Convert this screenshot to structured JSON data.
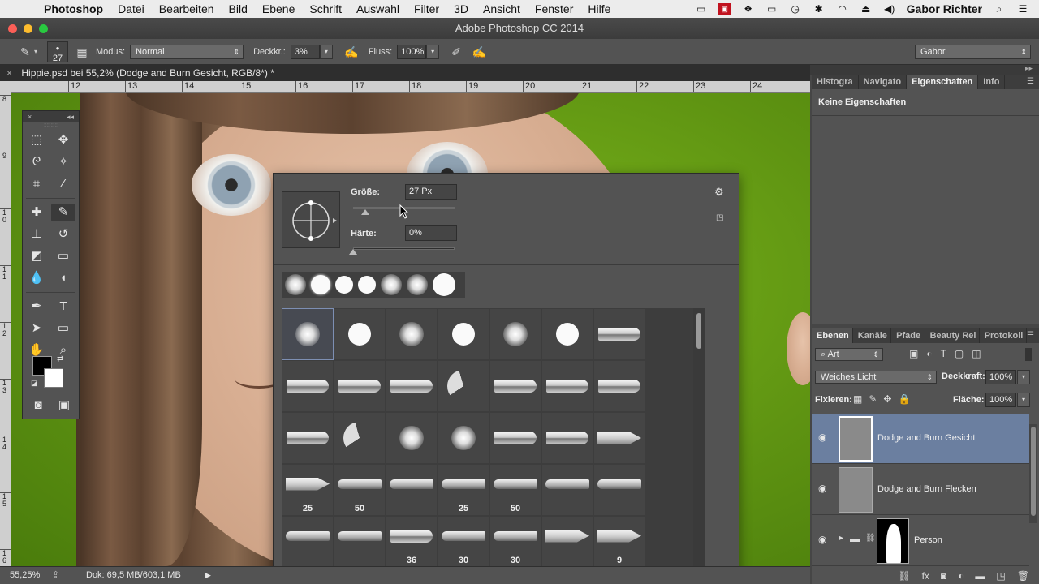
{
  "menubar": {
    "app_name": "Photoshop",
    "items": [
      "Datei",
      "Bearbeiten",
      "Bild",
      "Ebene",
      "Schrift",
      "Auswahl",
      "Filter",
      "3D",
      "Ansicht",
      "Fenster",
      "Hilfe"
    ],
    "user": "Gabor Richter"
  },
  "window": {
    "title": "Adobe Photoshop CC 2014"
  },
  "options": {
    "brush_size": "27",
    "mode_label": "Modus:",
    "mode_value": "Normal",
    "opacity_label": "Deckkr.:",
    "opacity_value": "3%",
    "flow_label": "Fluss:",
    "flow_value": "100%",
    "workspace": "Gabor"
  },
  "document": {
    "tab_title": "Hippie.psd bei 55,2% (Dodge and Burn Gesicht, RGB/8*) *",
    "ruler_h": [
      "12",
      "13",
      "14",
      "15",
      "16",
      "17",
      "18",
      "19",
      "20",
      "21",
      "22",
      "23",
      "24"
    ],
    "ruler_v": [
      "8",
      "9",
      "1\n0",
      "1\n1",
      "1\n2",
      "1\n3",
      "1\n4",
      "1\n5",
      "1\n6"
    ]
  },
  "brush_picker": {
    "size_label": "Größe:",
    "size_value": "27 Px",
    "size_fraction": 0.12,
    "hardness_label": "Härte:",
    "hardness_value": "0%",
    "hardness_fraction": 0.0,
    "preset_numbers": [
      "25",
      "50",
      "",
      "25",
      "50",
      "",
      "",
      "",
      "",
      "36",
      "30",
      "30",
      "",
      "9"
    ]
  },
  "properties": {
    "tabs": [
      "Histogra",
      "Navigato",
      "Eigenschaften",
      "Info"
    ],
    "active_tab": "Eigenschaften",
    "content": "Keine Eigenschaften"
  },
  "layers": {
    "tabs": [
      "Ebenen",
      "Kanäle",
      "Pfade",
      "Beauty Rei",
      "Protokoll"
    ],
    "filter_value": "Art",
    "blend_mode": "Weiches Licht",
    "opacity_label": "Deckkraft:",
    "opacity_value": "100%",
    "lock_label": "Fixieren:",
    "fill_label": "Fläche:",
    "fill_value": "100%",
    "items": [
      {
        "name": "Dodge and Burn Gesicht",
        "selected": true
      },
      {
        "name": "Dodge and Burn Flecken",
        "selected": false
      },
      {
        "name": "Person",
        "selected": false
      }
    ]
  },
  "status": {
    "zoom": "55,25%",
    "doc_info": "Dok: 69,5 MB/603,1 MB"
  },
  "colors": {
    "accent_selected_layer": "#6b7fa0",
    "canvas_green": "#6aa317"
  }
}
